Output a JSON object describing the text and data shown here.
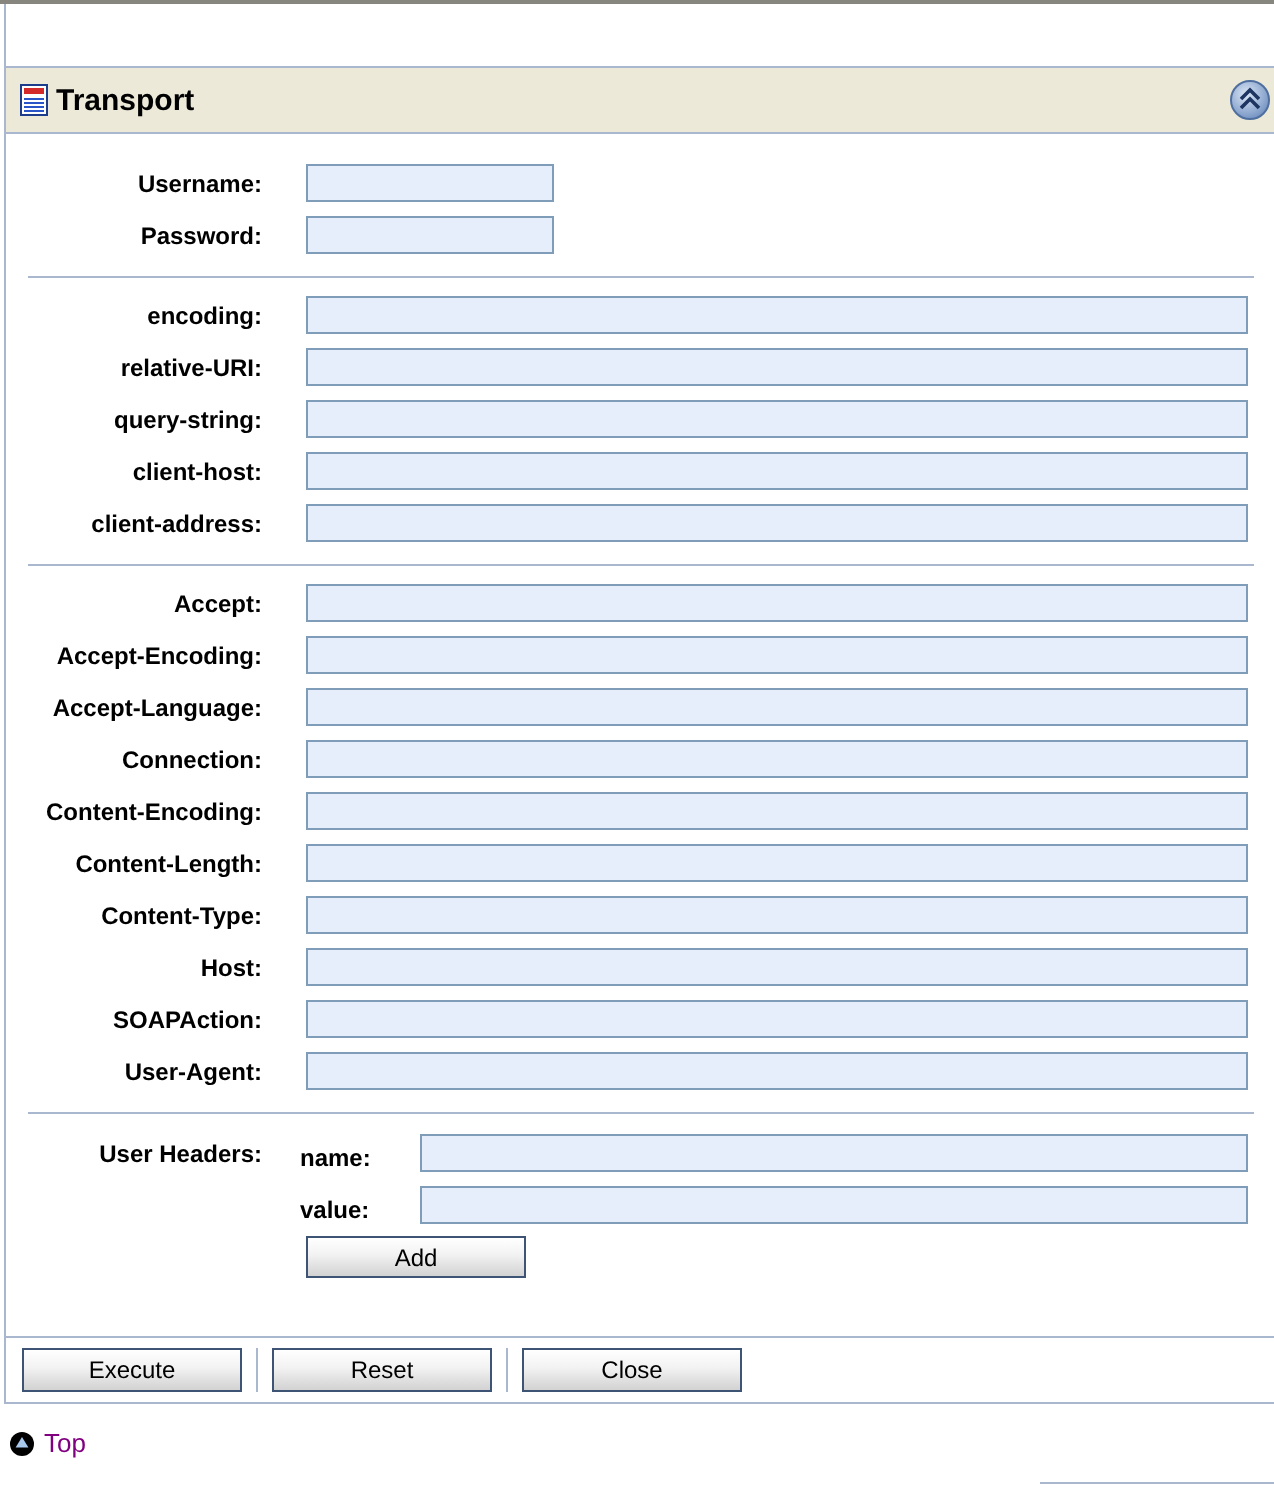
{
  "panel": {
    "title": "Transport"
  },
  "field_groups": [
    {
      "fields": [
        {
          "label": "Username:"
        },
        {
          "label": "Password:"
        }
      ]
    },
    {
      "fields": [
        {
          "label": "encoding:"
        },
        {
          "label": "relative-URI:"
        },
        {
          "label": "query-string:"
        },
        {
          "label": "client-host:"
        },
        {
          "label": "client-address:"
        }
      ]
    },
    {
      "fields": [
        {
          "label": "Accept:"
        },
        {
          "label": "Accept-Encoding:"
        },
        {
          "label": "Accept-Language:"
        },
        {
          "label": "Connection:"
        },
        {
          "label": "Content-Encoding:"
        },
        {
          "label": "Content-Length:"
        },
        {
          "label": "Content-Type:"
        },
        {
          "label": "Host:"
        },
        {
          "label": "SOAPAction:"
        },
        {
          "label": "User-Agent:"
        }
      ]
    }
  ],
  "user_headers": {
    "label": "User Headers:",
    "fields": [
      {
        "label": "name:"
      },
      {
        "label": "value:"
      }
    ],
    "add_button": "Add"
  },
  "actions": [
    "Execute",
    "Reset",
    "Close"
  ],
  "top_link": "Top"
}
